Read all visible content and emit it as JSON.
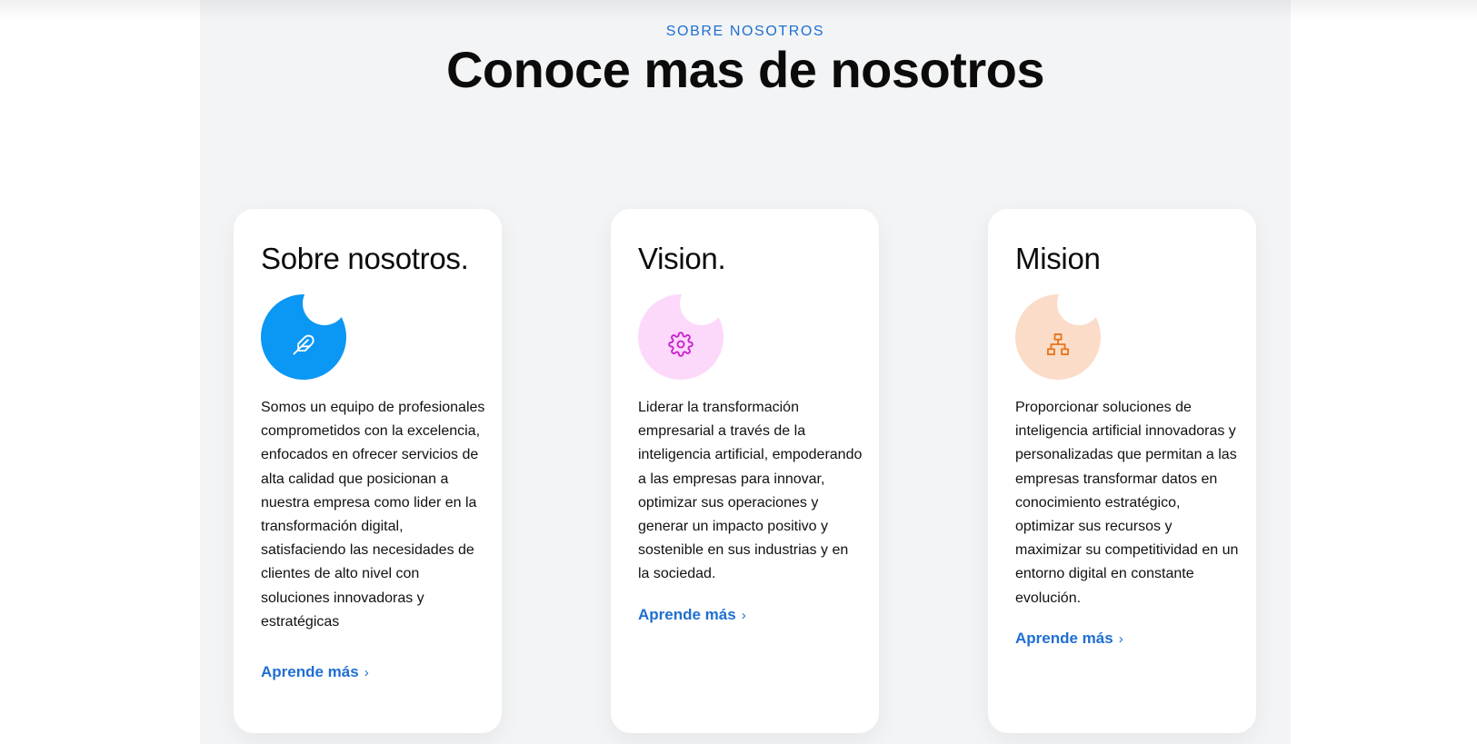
{
  "section": {
    "eyebrow": "SOBRE NOSOTROS",
    "title": "Conoce mas de nosotros"
  },
  "cards": [
    {
      "title": "Sobre nosotros.",
      "icon": "feather-icon",
      "icon_bg": "#0b97f4",
      "icon_color": "#ffffff",
      "body": "Somos un equipo de profesionales comprometidos con la excelencia, enfocados en ofrecer servicios de alta calidad que posicionan a nuestra empresa como lider en la transformación digital, satisfaciendo las necesidades de clientes de alto nivel con soluciones innovadoras y estratégicas",
      "link": "Aprende más"
    },
    {
      "title": "Vision.",
      "icon": "gear-icon",
      "icon_bg": "#fcd9fb",
      "icon_color": "#c91fcf",
      "body": "Liderar la transformación empresarial a través de la inteligencia artificial, empoderando a las empresas para innovar, optimizar sus operaciones y generar un impacto positivo y sostenible en sus industrias y en la sociedad.",
      "link": "Aprende más"
    },
    {
      "title": "Mision",
      "icon": "sitemap-icon",
      "icon_bg": "#fbdcc8",
      "icon_color": "#e8741d",
      "body": "Proporcionar soluciones de inteligencia artificial innovadoras y personalizadas que permitan a las empresas transformar datos en conocimiento estratégico, optimizar sus recursos y maximizar su competitividad en un entorno digital en constante evolución.",
      "link": "Aprende más"
    }
  ],
  "colors": {
    "accent": "#1f6fd1",
    "section_bg": "#f3f4f6",
    "card_bg": "#ffffff"
  }
}
